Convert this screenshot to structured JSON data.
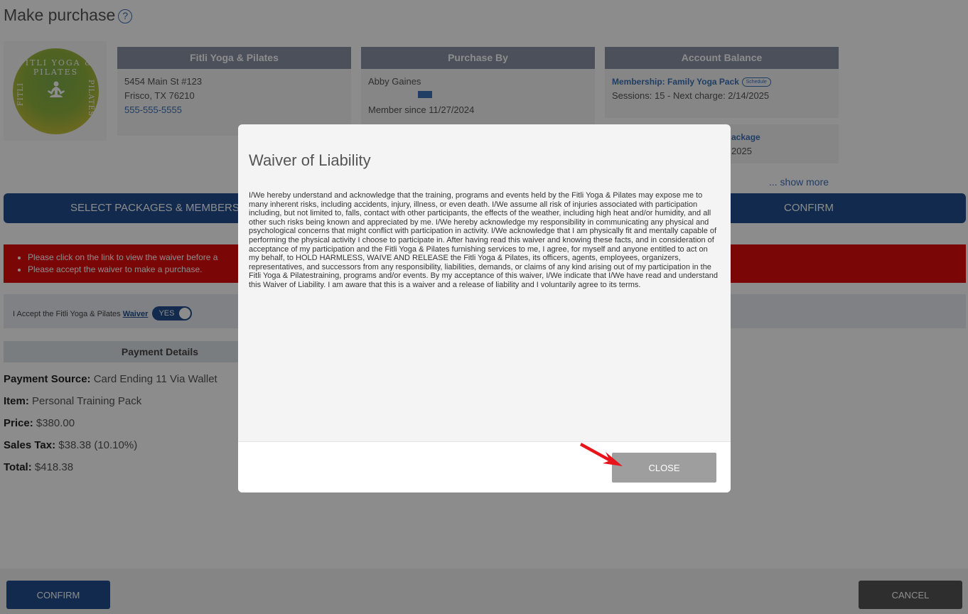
{
  "page": {
    "title": "Make purchase",
    "help_icon": "?"
  },
  "logo": {
    "top_text": "FITLI YOGA & PILATES",
    "side_left": "FITLI",
    "side_right": "PILATES"
  },
  "studio": {
    "name": "Fitli Yoga & Pilates",
    "address1": "5454 Main St #123",
    "address2": "Frisco, TX 76210",
    "phone": "555-555-5555"
  },
  "purchaser": {
    "heading": "Purchase By",
    "name": "Abby Gaines",
    "since": "Member since 11/27/2024"
  },
  "balance": {
    "heading": "Account Balance",
    "item1_title": "Membership: Family Yoga Pack",
    "item1_badge": "Schedule",
    "item1_detail": "Sessions: 15 - Next charge: 2/14/2025",
    "item2_title": "ackage",
    "item2_detail": "2025",
    "show_more": "... show more"
  },
  "steps": {
    "step1": "Select Packages & Members",
    "step2": "Confirm"
  },
  "errors": [
    "Please click on the link to view the waiver before a",
    "Please accept the waiver to make a purchase."
  ],
  "waiver_row": {
    "text": "I Accept the Fitli Yoga & Pilates",
    "link": "Waiver",
    "toggle": "YES"
  },
  "payment": {
    "heading": "Payment Details",
    "source_label": "Payment Source:",
    "source_value": "Card Ending 11 Via Wallet",
    "item_label": "Item:",
    "item_value": "Personal Training Pack",
    "price_label": "Price:",
    "price_value": "$380.00",
    "tax_label": "Sales Tax:",
    "tax_value": "$38.38 (10.10%)",
    "total_label": "Total:",
    "total_value": "$418.38"
  },
  "footer": {
    "confirm": "Confirm",
    "cancel": "Cancel"
  },
  "modal": {
    "title": "Waiver of Liability",
    "body": "I/We hereby understand and acknowledge that the training, programs and events held by the Fitli Yoga & Pilates may expose me to many inherent risks, including accidents, injury, illness, or even death. I/We assume all risk of injuries associated with participation including, but not limited to, falls, contact with other participants, the effects of the weather, including high heat and/or humidity, and all other such risks being known and appreciated by me. I/We hereby acknowledge my responsibility in communicating any physical and psychological concerns that might conflict with participation in activity. I/We acknowledge that I am physically fit and mentally capable of performing the physical activity I choose to participate in. After having read this waiver and knowing these facts, and in consideration of acceptance of my participation and the Fitli Yoga & Pilates furnishing services to me, I agree, for myself and anyone entitled to act on my behalf, to HOLD HARMLESS, WAIVE AND RELEASE the Fitli Yoga & Pilates, its officers, agents, employees, organizers, representatives, and successors from any responsibility, liabilities, demands, or claims of any kind arising out of my participation in the Fitli Yoga & Pilatestraining, programs and/or events. By my acceptance of this waiver, I/We indicate that I/We have read and understand this Waiver of Liability. I am aware that this is a waiver and a release of liability and I voluntarily agree to its terms.",
    "close": "Close"
  },
  "colors": {
    "primary": "#1f4d8c",
    "error": "#e10c0c",
    "card_header": "#8b93a5",
    "close_button": "#9e9e9e",
    "annotation_arrow": "#e8141c"
  },
  "icons": {
    "help": "question-circle-icon",
    "message": "message-icon",
    "arrow": "red-pointer-arrow-icon"
  }
}
